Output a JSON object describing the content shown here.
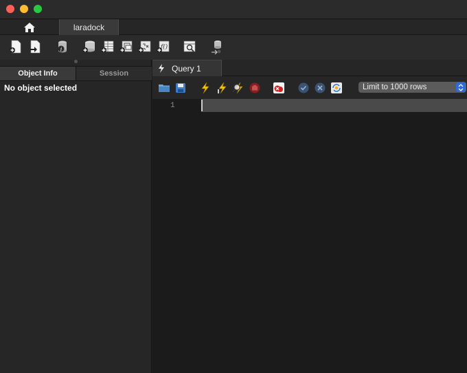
{
  "window": {
    "traffic_lights": {
      "close": "#fe5f57",
      "minimize": "#febc2e",
      "maximize": "#28c840"
    }
  },
  "connection_tabs": {
    "home_icon": "home-icon",
    "active_label": "laradock"
  },
  "main_toolbar": {
    "icons": [
      "new-sql-tab-icon",
      "open-sql-script-icon",
      "inspector-icon",
      "create-schema-icon",
      "create-table-icon",
      "create-view-icon",
      "create-procedure-icon",
      "create-function-icon",
      "search-table-data-icon",
      "reconnect-icon"
    ]
  },
  "sidebar": {
    "tabs": [
      "Object Info",
      "Session"
    ],
    "active_tab": "Object Info",
    "empty_message": "No object selected"
  },
  "query_tabs": [
    {
      "label": "Query 1",
      "icon": "lightning-icon"
    }
  ],
  "query_toolbar": {
    "icons": [
      "open-file-icon",
      "save-icon",
      "execute-icon",
      "execute-current-icon",
      "explain-icon",
      "stop-icon",
      "toggle-error-continue-icon",
      "commit-icon",
      "rollback-icon",
      "autocommit-icon"
    ],
    "limit_rows": "Limit to 1000 rows"
  },
  "editor": {
    "line_numbers": [
      "1"
    ],
    "content": ""
  }
}
